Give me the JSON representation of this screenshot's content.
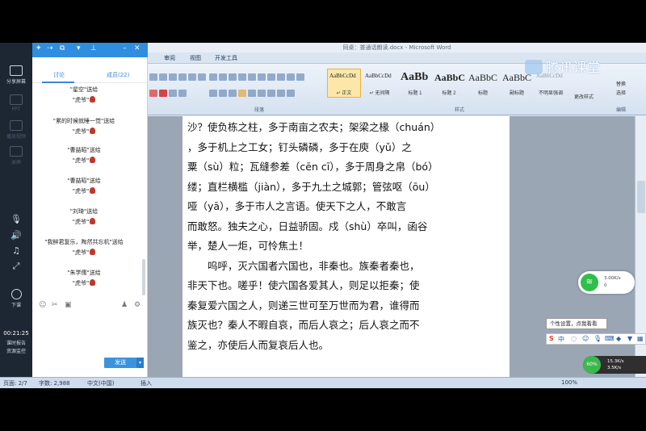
{
  "word": {
    "title": "同桌：普通话朗读.docx - Microsoft Word",
    "tabs": [
      "审阅",
      "视图",
      "开发工具"
    ],
    "group_paragraph": "段落",
    "group_styles": "样式",
    "group_edit": "编辑",
    "styles": [
      {
        "sample": "AaBbCcDd",
        "name": "↵ 正文"
      },
      {
        "sample": "AaBbCcDd",
        "name": "↵ 无间隔"
      },
      {
        "sample": "AaBb",
        "name": "标题 1"
      },
      {
        "sample": "AaBbC",
        "name": "标题 2"
      },
      {
        "sample": "AaBbC",
        "name": "标题"
      },
      {
        "sample": "AaBbC",
        "name": "副标题"
      },
      {
        "sample": "AaBbCcDd",
        "name": "不明显强调"
      }
    ],
    "change_styles": "更改样式",
    "replace": "替换",
    "select": "选择"
  },
  "document": {
    "lines": [
      "沙？使负栋之柱，多于南亩之农夫；架梁之椽（chuán）",
      "，多于机上之工女；钉头磷磷，多于在庾（yǔ）之",
      "粟（sù）粒；瓦缝参差（cēn cī），多于周身之帛（bó）",
      "缕；直栏横槛（jiàn），多于九土之城郭；管弦呕（ōu）",
      "哑（yā），多于市人之言语。使天下之人，不敢言",
      "而敢怒。独夫之心，日益骄固。戍（shù）卒叫，函谷",
      "举，楚人一炬，可怜焦土！",
      "　　呜呼，灭六国者六国也，非秦也。族秦者秦也，",
      "非天下也。嗟乎！使六国各爱其人，则足以拒秦；使",
      "秦复爱六国之人，则递三世可至万世而为君，谁得而",
      "族灭也？秦人不暇自哀，而后人哀之；后人哀之而不",
      "鉴之，亦使后人而复哀后人也。"
    ]
  },
  "status": {
    "page": "页面: 2/7",
    "words": "字数: 2,988",
    "lang": "中文(中国)",
    "mode": "插入",
    "zoom": "100%"
  },
  "left_panel": {
    "share_screen": "分享屏幕",
    "ppt": "PPT",
    "video": "播放视频",
    "record": "录屏",
    "class": "下课",
    "timer": "00:21:25",
    "timer_sub1": "课时报告",
    "timer_sub2": "资源监控"
  },
  "chat": {
    "tab_discuss": "讨论",
    "tab_members": "成员(22)",
    "messages": [
      {
        "who": "\"星空\"送给",
        "gift": "\"虎爷\""
      },
      {
        "who": "\"累的时候就睡一觉\"送给",
        "gift": "\"虎爷\""
      },
      {
        "who": "\"曹喆昭\"送给",
        "gift": "\"虎爷\""
      },
      {
        "who": "\"曹喆昭\"送给",
        "gift": "\"虎爷\""
      },
      {
        "who": "\"刘琦\"送给",
        "gift": "\"虎爷\""
      },
      {
        "who": "\"我醉君复乐，陶然共忘机\"送给",
        "gift": "\"虎爷\""
      },
      {
        "who": "\"朱学儒\"送给",
        "gift": "\"虎爷\""
      }
    ],
    "send": "发送"
  },
  "overlay": {
    "logo": "腾讯课堂",
    "net_up": "3.00K/s",
    "net_down": "0",
    "tooltip": "个性设置，点我看看",
    "ime": "中",
    "percent": "60%",
    "speed_up": "15.3K/s",
    "speed_down": "3.5K/s"
  }
}
